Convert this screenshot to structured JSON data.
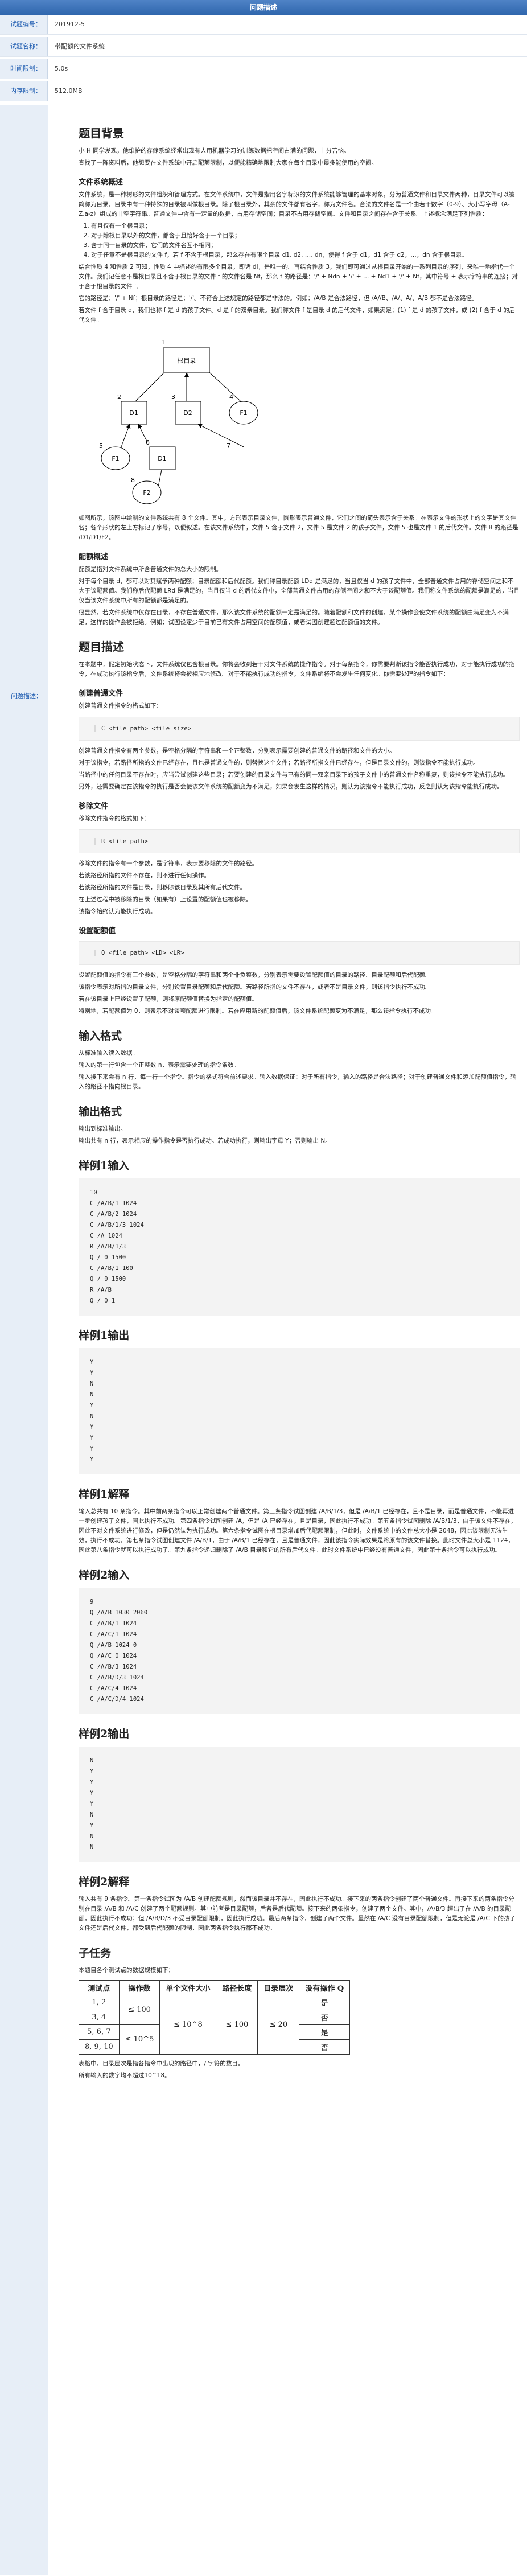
{
  "topbar_title": "问题描述",
  "meta": [
    {
      "label": "试题编号：",
      "value": "201912-5"
    },
    {
      "label": "试题名称：",
      "value": "带配额的文件系统"
    },
    {
      "label": "时间限制：",
      "value": "5.0s"
    },
    {
      "label": "内存限制：",
      "value": "512.0MB"
    }
  ],
  "desc_label": "问题描述：",
  "background": {
    "title": "题目背景",
    "p1": "小 H 同学发现，他维护的存储系统经常出现有人用机器学习的训练数据把空间占满的问题，十分苦恼。",
    "p2": "查找了一阵资料后，他想要在文件系统中开启配额限制，以便能精确地限制大家在每个目录中最多能使用的空间。"
  },
  "fs": {
    "title": "文件系统概述",
    "p1": "文件系统，是一种树形的文件组织和管理方式。在文件系统中，文件是指用名字标识的文件系统能够管理的基本对象，分为普通文件和目录文件两种，目录文件可以被简称为目录。目录中有一种特殊的目录被叫做根目录。除了根目录外，其余的文件都有名字，称为文件名。合法的文件名是一个由若干数字（0-9）、大小写字母（A-Z,a-z）组成的非空字符串。普通文件中含有一定量的数据，占用存储空间；目录不占用存储空间。文件和目录之间存在含于关系。上述概念满足下列性质：",
    "list": [
      "有且仅有一个根目录；",
      "对于除根目录以外的文件，都含于且恰好含于一个目录；",
      "含于同一目录的文件，它们的文件名互不相同；",
      "对于任意不是根目录的文件 f，若 f 不含于根目录，那么存在有限个目录 d1, d2, …, dn，使得 f 含于 d1，d1 含于 d2，…，dn 含于根目录。"
    ],
    "p2": "结合性质 4 和性质 2 可知，性质 4 中描述的有限多个目录，即诸 di，是唯一的。再结合性质 3，我们即可通过从根目录开始的一系列目录的序列，来唯一地指代一个文件。我们记任意不是根目录且不含于根目录的文件 f 的文件名是 Nf，那么 f 的路径是：'/' + Ndn + '/' + … + Nd1 + '/' + Nf，其中符号 + 表示字符串的连接；对于含于根目录的文件 f，",
    "p3": "它的路径是：'/' + Nf；根目录的路径是：'/'。不符合上述规定的路径都是非法的。例如：/A/B 是合法路径，但 /A//B、/A/、A/、A/B 都不是合法路径。",
    "p4": "若文件 f 含于目录 d，我们也称 f 是 d 的孩子文件。d 是 f 的双亲目录。我们称文件 f 是目录 d 的后代文件，如果满足：(1) f 是 d 的孩子文件，或 (2) f 含于 d 的后代文件。",
    "diagram": {
      "nodes": [
        "根目录",
        "D1",
        "D2",
        "F1",
        "F1",
        "D1",
        "F2"
      ],
      "edge_nums": [
        "1",
        "2",
        "3",
        "4",
        "5",
        "6",
        "7",
        "8"
      ]
    },
    "p5": "如图所示，该图中绘制的文件系统共有 8 个文件。其中，方形表示目录文件，圆形表示普通文件，它们之间的箭头表示含于关系。在表示文件的形状上的文字是其文件名；各个形状的左上方标记了序号，以便叙述。在该文件系统中，文件 5 含于文件 2，文件 5 是文件 2 的孩子文件，文件 5 也是文件 1 的后代文件。文件 8 的路径是 /D1/D1/F2。"
  },
  "quota": {
    "title": "配额概述",
    "p1": "配额是指对文件系统中所含普通文件的总大小的限制。",
    "p2": "对于每个目录 d，都可以对其赋予两种配额：目录配额和后代配额。我们称目录配额 LDd 是满足的，当且仅当 d 的孩子文件中，全部普通文件占用的存储空间之和不大于该配额值。我们称后代配额 LRd 是满足的，当且仅当 d 的后代文件中，全部普通文件占用的存储空间之和不大于该配额值。我们称文件系统的配额是满足的，当且仅当该文件系统中所有的配额都是满足的。",
    "p3": "很显然，若文件系统中仅存在目录，不存在普通文件，那么该文件系统的配额一定是满足的。随着配额和文件的创建，某个操作会使文件系统的配额由满足变为不满足，这样的操作会被拒绝。例如：试图设定少于目前已有文件占用空间的配额值，或者试图创建超过配额值的文件。"
  },
  "problem": {
    "title": "题目描述",
    "p1": "在本题中，假定初始状态下，文件系统仅包含根目录。你将会收到若干对文件系统的操作指令。对于每条指令，你需要判断该指令能否执行成功，对于能执行成功的指令，在成功执行该指令后，文件系统将会被相应地修改。对于不能执行成功的指令，文件系统将不会发生任何变化。你需要处理的指令如下：",
    "create": {
      "title": "创建普通文件",
      "p1": "创建普通文件指令的格式如下：",
      "code": "C <file path> <file size>",
      "p2": "创建普通文件指令有两个参数，是空格分隔的字符串和一个正整数，分别表示需要创建的普通文件的路径和文件的大小。",
      "p3": "对于该指令，若路径所指的文件已经存在，且也是普通文件的，则替换这个文件；若路径所指文件已经存在，但是目录文件的，则该指令不能执行成功。",
      "p4": "当路径中的任何目录不存在时，应当尝试创建这些目录；若要创建的目录文件与已有的同一双亲目录下的孩子文件中的普通文件名称重复，则该指令不能执行成功。",
      "p5": "另外，还需要确定在该指令的执行是否会使该文件系统的配额变为不满足，如果会发生这样的情况，则认为该指令不能执行成功，反之则认为该指令能执行成功。"
    },
    "remove": {
      "title": "移除文件",
      "p1": "移除文件指令的格式如下：",
      "code": "R <file path>",
      "p2": "移除文件的指令有一个参数，是字符串，表示要移除的文件的路径。",
      "p3": "若该路径所指的文件不存在，则不进行任何操作。",
      "p4": "若该路径所指的文件是目录，则移除该目录及其所有后代文件。",
      "p5": "在上述过程中被移除的目录（如果有）上设置的配额值也被移除。",
      "p6": "该指令始终认为能执行成功。"
    },
    "setq": {
      "title": "设置配额值",
      "p1": "",
      "code": "Q <file path> <LD> <LR>",
      "p2": "设置配额值的指令有三个参数，是空格分隔的字符串和两个非负整数，分别表示需要设置配额值的目录的路径、目录配额和后代配额。",
      "p3": "该指令表示对所指的目录文件，分别设置目录配额和后代配额。若路径所指的文件不存在，或者不是目录文件，则该指令执行不成功。",
      "p4": "若在该目录上已经设置了配额，则将原配额值替换为指定的配额值。",
      "p5": "特别地，若配额值为 0，则表示不对该项配额进行限制。若在应用新的配额值后，该文件系统配额变为不满足，那么该指令执行不成功。"
    }
  },
  "input": {
    "title": "输入格式",
    "p1": "从标准输入读入数据。",
    "p2": "输入的第一行包含一个正整数 n，表示需要处理的指令条数。",
    "p3": "输入接下来会有 n 行，每一行一个指令。指令的格式符合前述要求。输入数据保证：对于所有指令，输入的路径是合法路径；对于创建普通文件和添加配额值指令，输入的路径不指向根目录。"
  },
  "output": {
    "title": "输出格式",
    "p1": "输出到标准输出。",
    "p2": "输出共有 n 行，表示相应的操作指令是否执行成功。若成功执行，则输出字母 Y；否则输出 N。"
  },
  "sample1_in_title": "样例1输入",
  "sample1_in": "10\nC /A/B/1 1024\nC /A/B/2 1024\nC /A/B/1/3 1024\nC /A 1024\nR /A/B/1/3\nQ / 0 1500\nC /A/B/1 100\nQ / 0 1500\nR /A/B\nQ / 0 1",
  "sample1_out_title": "样例1输出",
  "sample1_out": "Y\nY\nN\nN\nY\nN\nY\nY\nY\nY",
  "sample1_exp_title": "样例1解释",
  "sample1_exp": "输入总共有 10 条指令。其中前两条指令可以正常创建两个普通文件。第三条指令试图创建 /A/B/1/3，但是 /A/B/1 已经存在，且不是目录，而是普通文件，不能再进一步创建孩子文件，因此执行不成功。第四条指令试图创建 /A，但是 /A 已经存在，且是目录，因此执行不成功。第五条指令试图删除 /A/B/1/3，由于该文件不存在，因此不对文件系统进行修改，但是仍然认为执行成功。第六条指令试图在根目录增加后代配额限制，但此时，文件系统中的文件总大小是 2048，因此该限制无法生效，执行不成功。第七条指令试图创建文件 /A/B/1，由于 /A/B/1 已经存在，且是普通文件，因此该指令实际效果是将原有的该文件替换。此时文件总大小是 1124，因此第八条指令就可以执行成功了。第九条指令递归删除了 /A/B 目录和它的所有后代文件。此时文件系统中已经没有普通文件，因此第十条指令可以执行成功。",
  "sample2_in_title": "样例2输入",
  "sample2_in": "9\nQ /A/B 1030 2060\nC /A/B/1 1024\nC /A/C/1 1024\nQ /A/B 1024 0\nQ /A/C 0 1024\nC /A/B/3 1024\nC /A/B/D/3 1024\nC /A/C/4 1024\nC /A/C/D/4 1024",
  "sample2_out_title": "样例2输出",
  "sample2_out": "N\nY\nY\nY\nY\nN\nY\nN\nN",
  "sample2_exp_title": "样例2解释",
  "sample2_exp": "输入共有 9 条指令。第一条指令试图为 /A/B 创建配额规则，然而该目录并不存在，因此执行不成功。接下来的两条指令创建了两个普通文件。再接下来的两条指令分别在目录 /A/B 和 /A/C 创建了两个配额规则。其中前者是目录配额，后者是后代配额。接下来的两条指令，创建了两个文件。其中，/A/B/3 超出了在 /A/B 的目录配额，因此执行不成功；但 /A/B/D/3 不受目录配额限制，因此执行成功。最后两条指令，创建了两个文件。虽然在 /A/C 没有目录配额限制，但是无论是 /A/C 下的孩子文件还是后代文件，都受到后代配额的限制，因此两条指令执行都不成功。",
  "subtask": {
    "title": "子任务",
    "p1": "本题目各个测试点的数据规模如下：",
    "headers": [
      "测试点",
      "操作数",
      "单个文件大小",
      "路径长度",
      "目录层次",
      "没有操作 Q"
    ],
    "rows": [
      {
        "pt": "1, 2",
        "op": "",
        "size": "",
        "len": "",
        "depth": "",
        "noq": "是"
      },
      {
        "pt": "3, 4",
        "op": "≤ 100",
        "size": "",
        "len": "",
        "depth": "",
        "noq": "否"
      },
      {
        "pt": "5, 6, 7",
        "op": "",
        "size": "≤ 10^8",
        "len": "≤ 100",
        "depth": "≤ 20",
        "noq": "是"
      },
      {
        "pt": "8, 9, 10",
        "op": "≤ 10^5",
        "size": "",
        "len": "",
        "depth": "",
        "noq": "否"
      }
    ],
    "p2": "表格中，目录层次是指各指令中出现的路径中，/ 字符的数目。",
    "p3": "所有输入的数字均不超过10^18。"
  }
}
